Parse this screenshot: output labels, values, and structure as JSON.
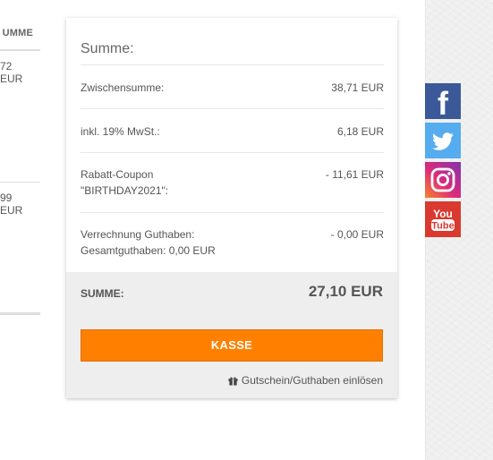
{
  "left_table": {
    "header": "UMME",
    "amounts": [
      "72 EUR",
      "99 EUR"
    ]
  },
  "summary": {
    "title": "Summe:",
    "rows": [
      {
        "label": "Zwischensumme:",
        "value": "38,71 EUR"
      },
      {
        "label": "inkl. 19% MwSt.:",
        "value": "6,18 EUR"
      },
      {
        "label_line1": "Rabatt-Coupon",
        "label_line2": "\"BIRTHDAY2021\":",
        "value": "- 11,61 EUR"
      },
      {
        "label_line1": "Verrechnung Guthaben:",
        "label_line2": "Gesamtguthaben: 0,00 EUR",
        "value": "- 0,00 EUR"
      }
    ],
    "total_label": "SUMME:",
    "total_value": "27,10 EUR",
    "checkout_label": "KASSE",
    "voucher_link": "Gutschein/Guthaben einlösen"
  },
  "social": [
    {
      "name": "facebook",
      "color": "#3b5998",
      "glyph": "f"
    },
    {
      "name": "twitter",
      "color": "#55acee"
    },
    {
      "name": "instagram",
      "color": "#c13584"
    },
    {
      "name": "youtube",
      "color": "#d9392f",
      "line1": "You",
      "line2": "Tube"
    }
  ],
  "colors": {
    "accent": "#ff8000",
    "card_footer": "#eeeeee"
  }
}
